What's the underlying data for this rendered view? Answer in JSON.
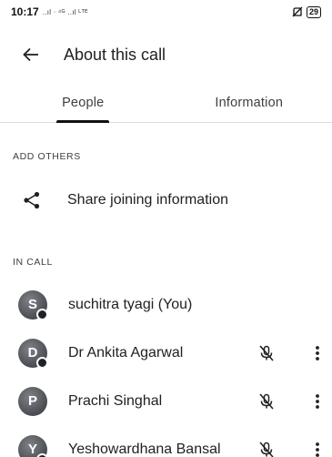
{
  "status_bar": {
    "time": "10:17",
    "network": "..ıl ᐧ ⁴ᴳ ..ıl ᴸᵀᴱ",
    "battery": "29"
  },
  "app_bar": {
    "title": "About this call"
  },
  "tabs": [
    {
      "label": "People",
      "active": true
    },
    {
      "label": "Information",
      "active": false
    }
  ],
  "add_others": {
    "header": "ADD OTHERS",
    "share_label": "Share joining information"
  },
  "in_call": {
    "header": "IN CALL",
    "participants": [
      {
        "initial": "S",
        "name": "suchitra tyagi (You)",
        "muted_icon": false,
        "more": false
      },
      {
        "initial": "D",
        "name": "Dr Ankita Agarwal",
        "muted_icon": true,
        "more": true
      },
      {
        "initial": "P",
        "name": "Prachi Singhal",
        "muted_icon": true,
        "more": true
      },
      {
        "initial": "Y",
        "name": "Yeshowardhana Bansal",
        "muted_icon": true,
        "more": true
      }
    ]
  },
  "icons": {
    "back": "arrow-back-icon",
    "share": "share-icon",
    "mic_off": "mic-off-icon",
    "more": "more-vert-icon"
  }
}
